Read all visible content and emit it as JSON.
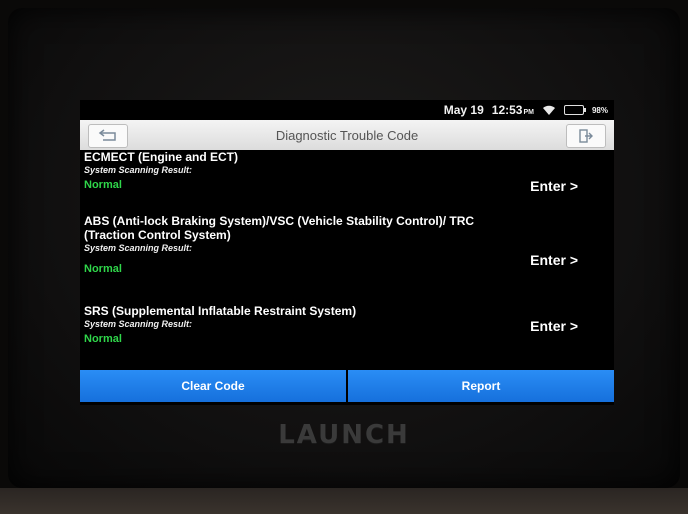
{
  "device": {
    "brand": "LAUNCH"
  },
  "statusbar": {
    "date": "May 19",
    "time": "12:53",
    "ampm": "PM",
    "battery_pct": "98%",
    "battery_level": 0.98,
    "icons": [
      "wifi-icon",
      "battery-icon"
    ]
  },
  "titlebar": {
    "title": "Diagnostic Trouble Code",
    "back_icon": "back-arrow-icon",
    "exit_icon": "exit-icon"
  },
  "systems": [
    {
      "name": "ECMECT (Engine and ECT)",
      "result_label": "System Scanning Result:",
      "status": "Normal",
      "action": "Enter >"
    },
    {
      "name": "ABS (Anti-lock Braking System)/VSC (Vehicle Stability Control)/ TRC (Traction Control System)",
      "result_label": "System Scanning Result:",
      "status": "Normal",
      "action": "Enter >"
    },
    {
      "name": "SRS (Supplemental Inflatable Restraint System)",
      "result_label": "System Scanning Result:",
      "status": "Normal",
      "action": "Enter >"
    }
  ],
  "buttons": {
    "clear_code": "Clear Code",
    "report": "Report"
  },
  "colors": {
    "status_normal": "#2fd64a",
    "button_blue": "#1e7fe8",
    "titlebar": "#e8e8e8"
  }
}
